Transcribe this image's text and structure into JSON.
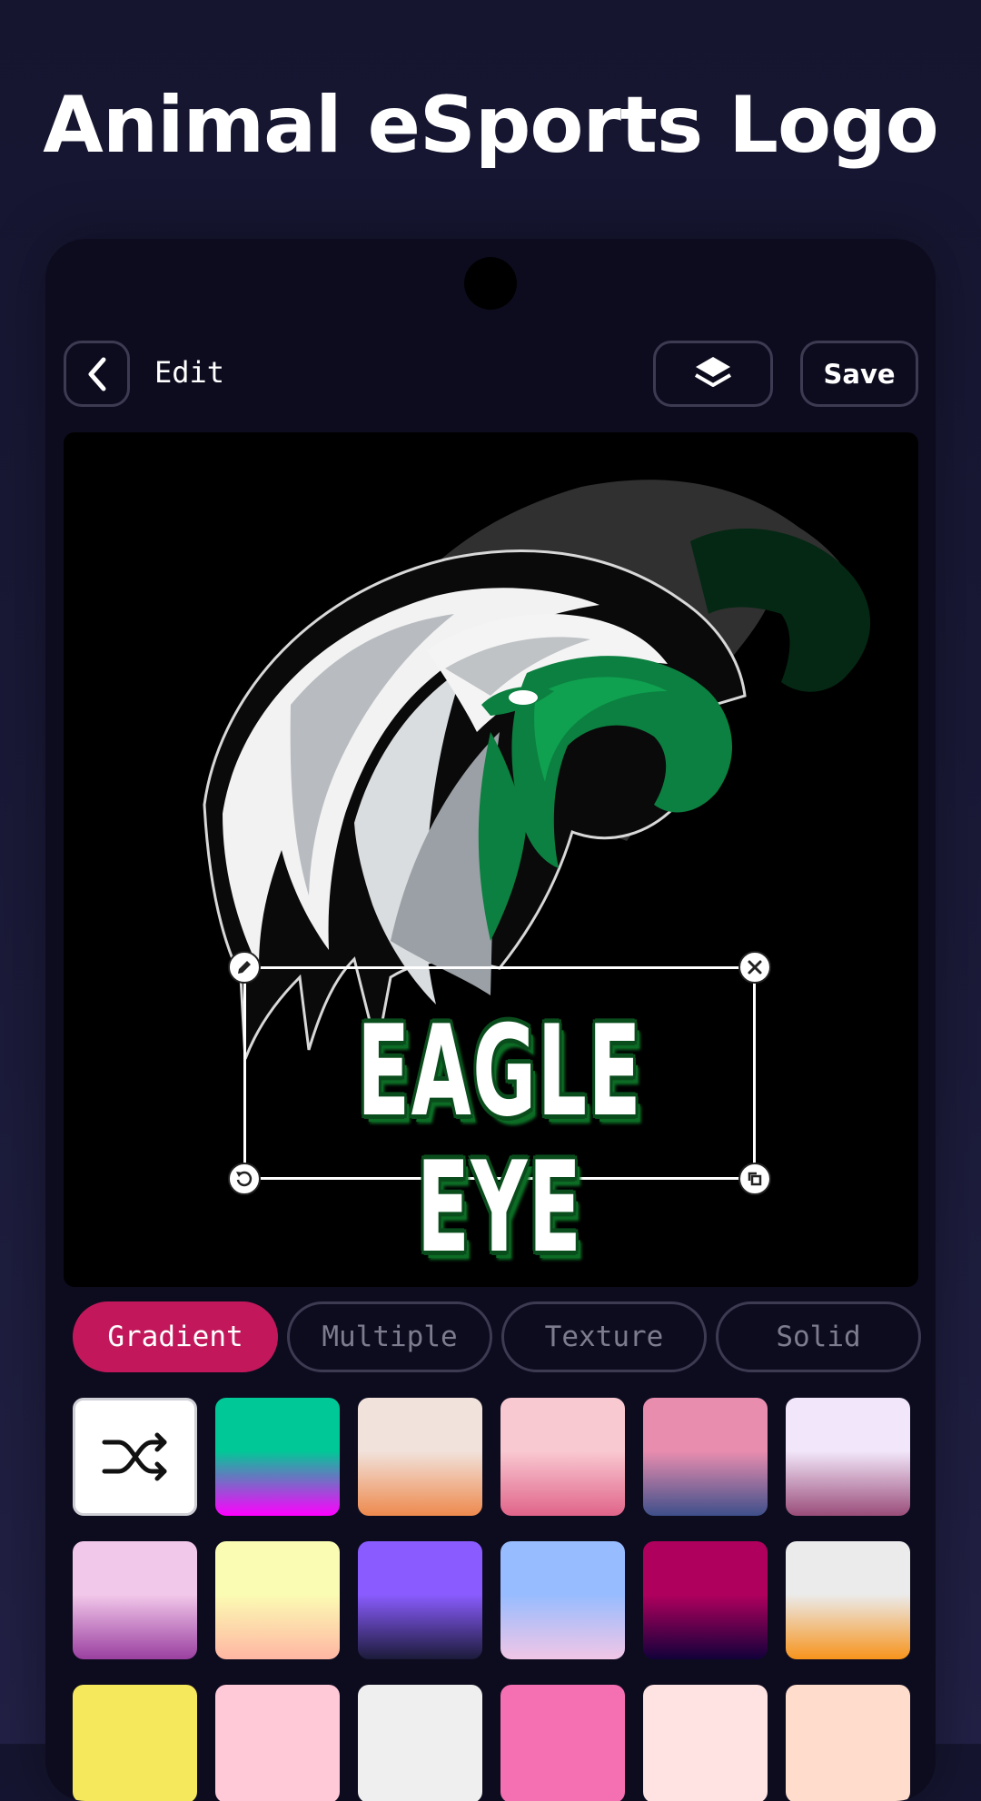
{
  "headline": "Animal eSports Logo",
  "toolbar": {
    "back_icon": "chevron-left-icon",
    "title": "Edit",
    "layers_icon": "layers-icon",
    "save_label": "Save"
  },
  "canvas": {
    "logo_text": "EAGLE EYE",
    "handles": [
      "edit-icon",
      "close-icon",
      "rotate-icon",
      "resize-icon"
    ]
  },
  "tabs": [
    {
      "label": "Gradient",
      "active": true
    },
    {
      "label": "Multiple",
      "active": false
    },
    {
      "label": "Texture",
      "active": false
    },
    {
      "label": "Solid",
      "active": false
    }
  ],
  "swatches": {
    "shuffle_icon": "shuffle-icon",
    "gradients": [
      [
        "#00c896",
        "#00c896",
        "#ff00ff"
      ],
      [
        "#f1e2db",
        "#f1e2db",
        "#ee8a4e"
      ],
      [
        "#f9c9d1",
        "#f9c9d1",
        "#e0648a"
      ],
      [
        "#e98daf",
        "#e98daf",
        "#3e4f8a"
      ],
      [
        "#f2e7fa",
        "#f2e7fa",
        "#9a4d7a"
      ],
      [
        "#f2c8ea",
        "#f2c8ea",
        "#9a3fa0"
      ],
      [
        "#fbfcb3",
        "#fbfcb3",
        "#ffb6a3"
      ],
      [
        "#8a5cff",
        "#8a5cff",
        "#1c1b3a"
      ],
      [
        "#97bcff",
        "#97bcff",
        "#f1c6e6"
      ],
      [
        "#b0005e",
        "#b0005e",
        "#12013a"
      ],
      [
        "#ebebeb",
        "#ebebeb",
        "#f7941d"
      ],
      [
        "#f6e85d",
        "#f6e85d",
        "#f6e85d"
      ],
      [
        "#ffc9d8",
        "#ffc9d8",
        "#ffc9d8"
      ],
      [
        "#efefef",
        "#efefef",
        "#efefef"
      ],
      [
        "#f56fb3",
        "#f56fb3",
        "#f56fb3"
      ],
      [
        "#ffe2e2",
        "#ffe2e2",
        "#ffe2e2"
      ],
      [
        "#ffdccc",
        "#ffdccc",
        "#ffdccc"
      ]
    ]
  },
  "colors": {
    "accent": "#c2185b",
    "eagle_green": "#0c8040",
    "text_outline": "#0a4d1c"
  }
}
